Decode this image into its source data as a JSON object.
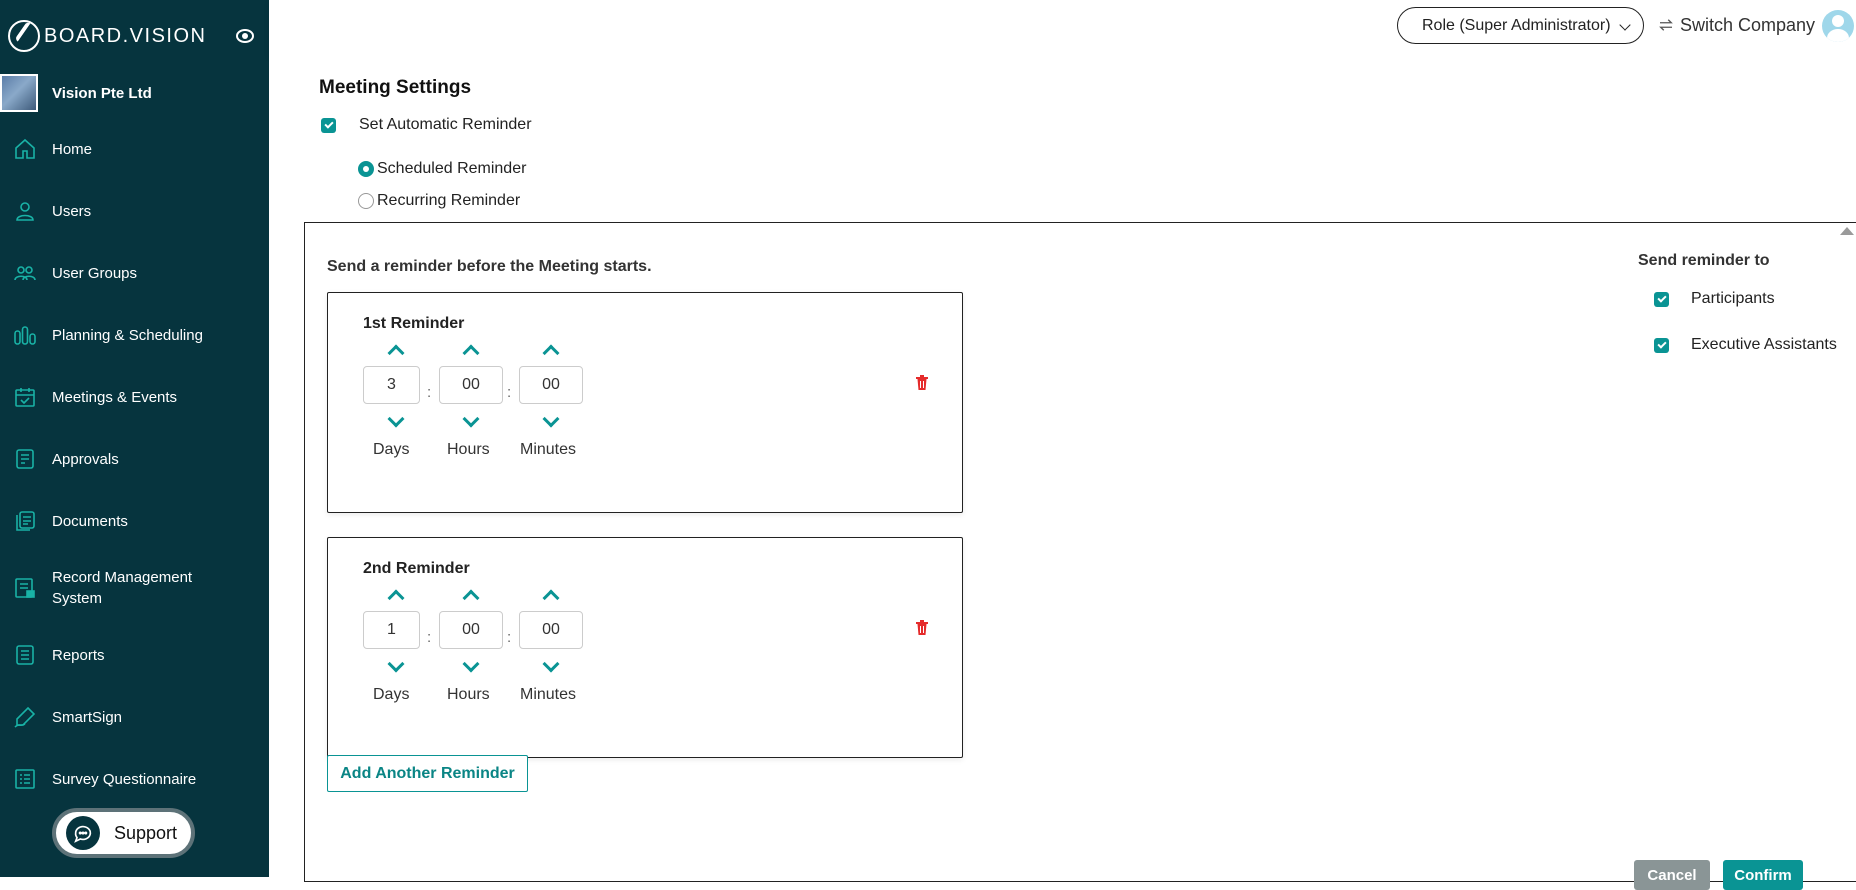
{
  "brand": {
    "name": "BOARD.VISION"
  },
  "company": {
    "name": "Vision Pte Ltd"
  },
  "sidebar": {
    "items": [
      {
        "label": "Home",
        "icon": "home-icon"
      },
      {
        "label": "Users",
        "icon": "user-icon"
      },
      {
        "label": "User Groups",
        "icon": "user-group-icon"
      },
      {
        "label": "Planning & Scheduling",
        "icon": "planning-icon"
      },
      {
        "label": "Meetings & Events",
        "icon": "calendar-check-icon"
      },
      {
        "label": "Approvals",
        "icon": "approval-icon"
      },
      {
        "label": "Documents",
        "icon": "documents-icon"
      },
      {
        "label": "Record Management System",
        "icon": "record-icon"
      },
      {
        "label": "Reports",
        "icon": "reports-icon"
      },
      {
        "label": "SmartSign",
        "icon": "signature-icon"
      },
      {
        "label": "Survey Questionnaire",
        "icon": "survey-icon"
      }
    ],
    "support_label": "Support"
  },
  "topbar": {
    "role_label": "Role (Super Administrator)",
    "switch_company_label": "Switch Company"
  },
  "main": {
    "title": "Meeting Settings",
    "auto_reminder_label": "Set Automatic Reminder",
    "auto_reminder_checked": true,
    "reminder_types": [
      {
        "label": "Scheduled Reminder",
        "selected": true
      },
      {
        "label": "Recurring Reminder",
        "selected": false
      }
    ],
    "send_before_label": "Send a reminder before the Meeting starts.",
    "reminders": [
      {
        "title": "1st Reminder",
        "days": "3",
        "hours": "00",
        "minutes": "00"
      },
      {
        "title": "2nd Reminder",
        "days": "1",
        "hours": "00",
        "minutes": "00"
      }
    ],
    "units": {
      "days": "Days",
      "hours": "Hours",
      "minutes": "Minutes"
    },
    "add_reminder_label": "Add Another Reminder",
    "send_to": {
      "title": "Send reminder to",
      "options": [
        {
          "label": "Participants",
          "checked": true
        },
        {
          "label": "Executive Assistants",
          "checked": true
        }
      ]
    },
    "cancel_label": "Cancel",
    "confirm_label": "Confirm"
  },
  "colors": {
    "sidebar": "#06343e",
    "accent": "#0a9494",
    "danger": "#e52b2b"
  }
}
